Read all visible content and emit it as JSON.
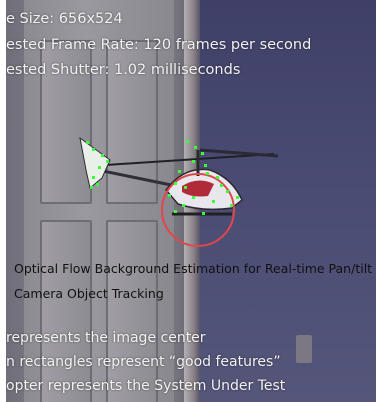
{
  "overlay": {
    "frame_size": "e Size: 656x524",
    "frame_rate": "ested Frame Rate: 120  frames per second",
    "shutter": "ested Shutter: 1.02 milliseconds"
  },
  "caption": {
    "title_line1": "Optical Flow Background Estimation for Real-time Pan/tilt",
    "title_line2": "Camera Object Tracking"
  },
  "legend": {
    "line1": "represents the image center",
    "line2": "n rectangles represent “good features”",
    "line3": "opter represents the System Under Test"
  },
  "colors": {
    "marker_circle": "#e0474c",
    "feature_points": "#3cff3c"
  }
}
